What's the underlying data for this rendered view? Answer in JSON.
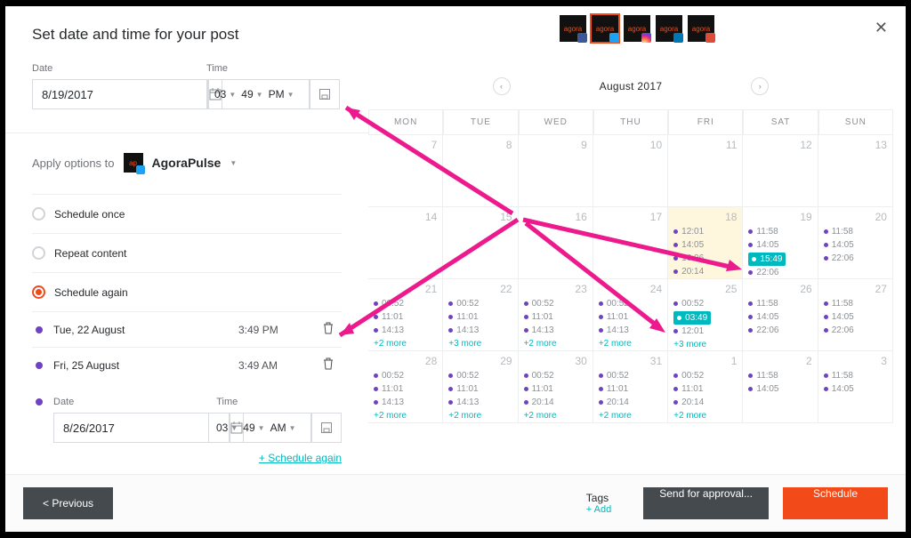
{
  "title": "Set date and time for your post",
  "labels": {
    "date": "Date",
    "time": "Time"
  },
  "datetime": {
    "date": "8/19/2017",
    "hour": "03",
    "min": "49",
    "ampm": "PM"
  },
  "apply": {
    "label": "Apply options to",
    "target": "AgoraPulse"
  },
  "radios": {
    "once": "Schedule once",
    "repeat": "Repeat content",
    "again": "Schedule again"
  },
  "scheduled": [
    {
      "date": "Tue, 22 August",
      "time": "3:49 PM"
    },
    {
      "date": "Fri, 25 August",
      "time": "3:49 AM"
    }
  ],
  "newdate": {
    "date": "8/26/2017",
    "hour": "03",
    "min": "49",
    "ampm": "AM"
  },
  "scheduleAgainLink": "+ Schedule again",
  "calendar": {
    "title": "August 2017",
    "dow": [
      "MON",
      "TUE",
      "WED",
      "THU",
      "FRI",
      "SAT",
      "SUN"
    ],
    "weeks": [
      [
        {
          "n": 7
        },
        {
          "n": 8
        },
        {
          "n": 9
        },
        {
          "n": 10
        },
        {
          "n": 11
        },
        {
          "n": 12
        },
        {
          "n": 13
        }
      ],
      [
        {
          "n": 14
        },
        {
          "n": 15
        },
        {
          "n": 16
        },
        {
          "n": 17
        },
        {
          "n": 18,
          "hl": true,
          "ev": [
            "12:01",
            "14:05",
            "16:06",
            "20:14"
          ]
        },
        {
          "n": 19,
          "ev": [
            "11:58",
            "14:05"
          ],
          "hlEv": "15:49",
          "ev2": [
            "22:06"
          ]
        },
        {
          "n": 20,
          "ev": [
            "11:58",
            "14:05",
            "22:06"
          ]
        }
      ],
      [
        {
          "n": 21,
          "ev": [
            "00:52",
            "11:01",
            "14:13"
          ],
          "more": "+2 more"
        },
        {
          "n": 22,
          "ev": [
            "00:52",
            "11:01",
            "14:13"
          ],
          "more": "+3 more"
        },
        {
          "n": 23,
          "ev": [
            "00:52",
            "11:01",
            "14:13"
          ],
          "more": "+2 more"
        },
        {
          "n": 24,
          "ev": [
            "00:52",
            "11:01",
            "14:13"
          ],
          "more": "+2 more"
        },
        {
          "n": 25,
          "ev": [
            "00:52"
          ],
          "hlEv": "03:49",
          "ev2": [
            "12:01"
          ],
          "more": "+3 more"
        },
        {
          "n": 26,
          "ev": [
            "11:58",
            "14:05",
            "22:06"
          ]
        },
        {
          "n": 27,
          "ev": [
            "11:58",
            "14:05",
            "22:06"
          ]
        }
      ],
      [
        {
          "n": 28,
          "ev": [
            "00:52",
            "11:01",
            "14:13"
          ],
          "more": "+2 more"
        },
        {
          "n": 29,
          "ev": [
            "00:52",
            "11:01",
            "14:13"
          ],
          "more": "+2 more"
        },
        {
          "n": 30,
          "ev": [
            "00:52",
            "11:01",
            "20:14"
          ],
          "more": "+2 more"
        },
        {
          "n": 31,
          "ev": [
            "00:52",
            "11:01",
            "20:14"
          ],
          "more": "+2 more"
        },
        {
          "n": 1,
          "ev": [
            "00:52",
            "11:01",
            "20:14"
          ],
          "more": "+2 more"
        },
        {
          "n": 2,
          "ev": [
            "11:58",
            "14:05"
          ]
        },
        {
          "n": 3,
          "ev": [
            "11:58",
            "14:05"
          ]
        }
      ]
    ]
  },
  "footer": {
    "prev": "< Previous",
    "tags": "Tags",
    "add": "+ Add",
    "approval": "Send for approval...",
    "schedule": "Schedule"
  }
}
